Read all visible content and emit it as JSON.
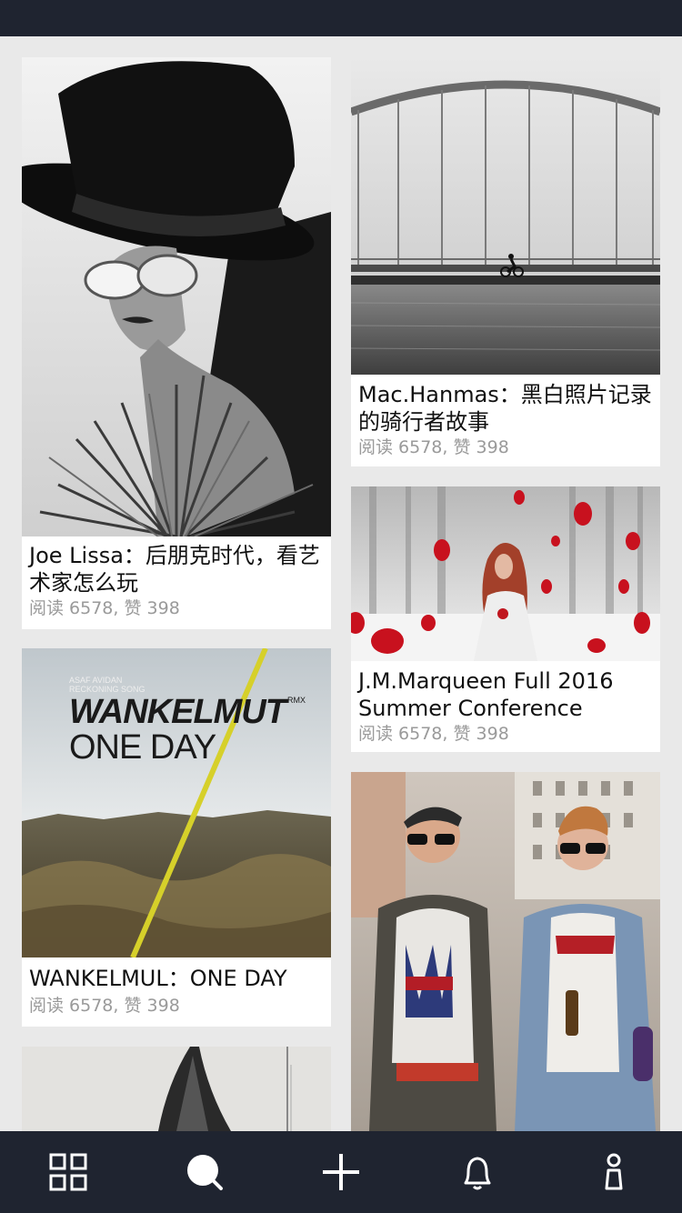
{
  "colors": {
    "status_bar": "#1f2430",
    "tab_bar": "#1f2430",
    "tab_icon": "#ffffff",
    "feed_background": "#e9e9e9",
    "card_background": "#ffffff",
    "meta_text": "#9a9a9a",
    "album_accent": "#d6d02a"
  },
  "feed": {
    "cards": [
      {
        "title": "Joe Lissa：后朋克时代，看艺术家怎么玩",
        "meta": "阅读 6578, 赞 398",
        "image": "woman-in-black-hat-photo"
      },
      {
        "title": "Mac.Hanmas：黑白照片记录的骑行者故事",
        "meta": "阅读 6578, 赞 398",
        "image": "cyclist-on-bridge-photo"
      },
      {
        "title": "J.M.Marqueen Full 2016 Summer Conference",
        "meta": "阅读 6578, 赞 398",
        "image": "red-haired-woman-with-rose-photo"
      },
      {
        "title": "WANKELMUL：ONE DAY",
        "meta": "阅读 6578, 赞 398",
        "image": "album-cover-photo",
        "album": {
          "artist": "ASAF AVIDAN",
          "song": "RECKONING SONG",
          "title": "WANKELMUT",
          "suffix": "RMX",
          "subtitle": "ONE DAY"
        }
      },
      {
        "title": "",
        "meta": "",
        "image": "two-men-street-photo"
      },
      {
        "title": "",
        "meta": "",
        "image": "gray-abstract-photo"
      }
    ]
  },
  "tab_bar": {
    "tabs": [
      {
        "icon": "grid-icon"
      },
      {
        "icon": "search-icon"
      },
      {
        "icon": "plus-icon"
      },
      {
        "icon": "bell-icon"
      },
      {
        "icon": "profile-icon"
      }
    ]
  }
}
